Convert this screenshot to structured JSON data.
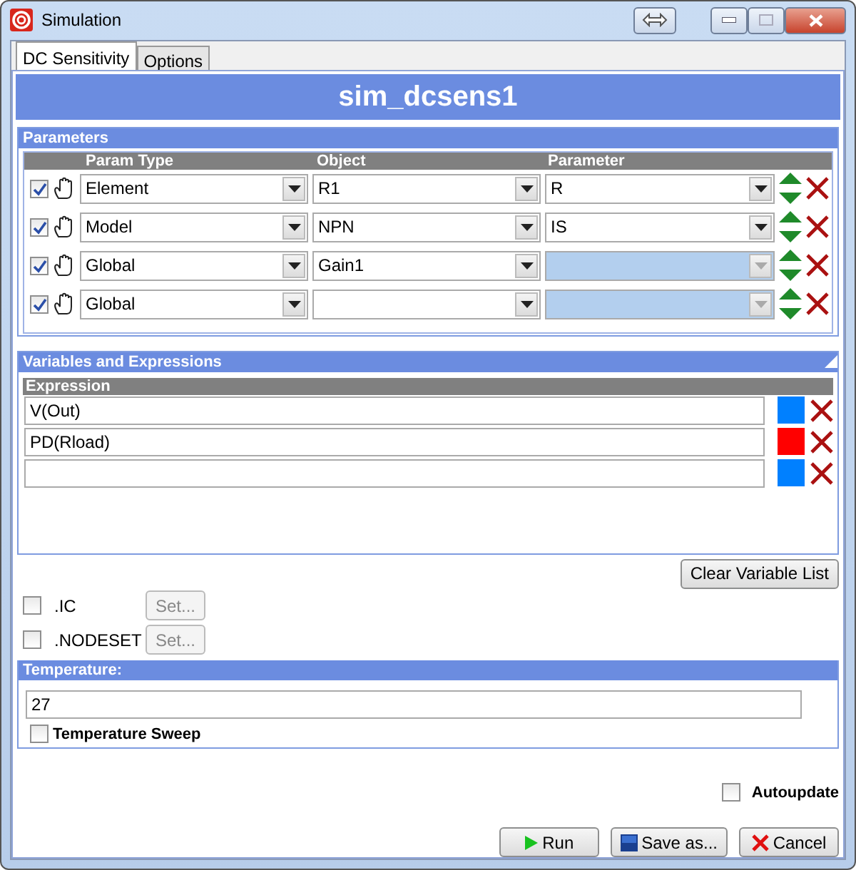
{
  "window": {
    "title": "Simulation"
  },
  "tabs": [
    {
      "label": "DC Sensitivity",
      "selected": true
    },
    {
      "label": "Options",
      "selected": false
    }
  ],
  "header": "sim_dcsens1",
  "parameters": {
    "title": "Parameters",
    "columns": [
      "Param Type",
      "Object",
      "Parameter"
    ],
    "rows": [
      {
        "checked": true,
        "param_type": "Element",
        "object": "R1",
        "parameter": {
          "value": "R",
          "disabled": false
        }
      },
      {
        "checked": true,
        "param_type": "Model",
        "object": "NPN",
        "parameter": {
          "value": "IS",
          "disabled": false
        }
      },
      {
        "checked": true,
        "param_type": "Global",
        "object": "Gain1",
        "parameter": {
          "disabled": true
        }
      },
      {
        "checked": true,
        "param_type": "Global",
        "parameter": {
          "disabled": true
        }
      }
    ]
  },
  "variables": {
    "title": "Variables and Expressions",
    "column": "Expression",
    "rows": [
      {
        "expression": "V(Out)",
        "color": "#0080ff"
      },
      {
        "expression": "PD(Rload)",
        "color": "#ff0000"
      },
      {
        "color": "#0080ff"
      }
    ]
  },
  "clear_button": "Clear Variable List",
  "options": [
    {
      "label": ".IC",
      "checked": false,
      "button": "Set...",
      "disabled": true
    },
    {
      "label": ".NODESET",
      "checked": false,
      "button": "Set...",
      "disabled": true
    }
  ],
  "temperature": {
    "title": "Temperature:",
    "value": "27",
    "sweep": {
      "label": "Temperature Sweep",
      "checked": false
    }
  },
  "autoupdate": {
    "label": "Autoupdate",
    "checked": false
  },
  "buttons": [
    {
      "kind": "run",
      "label": "Run"
    },
    {
      "kind": "save",
      "label": "Save as..."
    },
    {
      "kind": "cancel",
      "label": "Cancel"
    }
  ]
}
